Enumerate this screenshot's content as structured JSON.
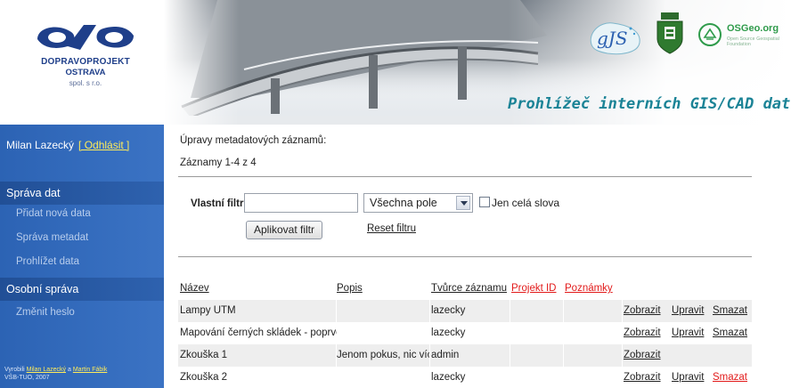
{
  "header": {
    "logo": {
      "line1": "DOPRAVOPROJEKT",
      "line2": "OSTRAVA",
      "line3": "spol. s r.o."
    },
    "banner_title": "Prohlížeč interních GIS/CAD dat",
    "osgeo_text": "OSGeo.org",
    "osgeo_sub": "Open Source Geospatial Foundation",
    "colors": {
      "title": "#1b8396",
      "logo_blue": "#1f3f8a",
      "osgeo_green": "#2f9b4b"
    }
  },
  "sidebar": {
    "user_name": "Milan Lazecký",
    "logout_label": "[ Odhlásit ]",
    "data_section": "Správa dat",
    "data_items": [
      "Přidat nová data",
      "Správa metadat",
      "Prohlížet data"
    ],
    "personal_section": "Osobní správa",
    "personal_items": [
      "Změnit heslo"
    ],
    "credits": {
      "prefix": "Vyrobili",
      "author1": "Milan Lazecký",
      "and": "a",
      "author2": "Martin Fábik",
      "org": "VŠB-TUO, 2007"
    },
    "colors": {
      "background": "#3b73c4",
      "link": "#ffec5a"
    }
  },
  "main": {
    "title": "Úpravy metadatových záznamů:",
    "records_label": "Záznamy 1-4 z 4",
    "filter": {
      "label": "Vlastní filtr",
      "input_value": "",
      "field_select_value": "Všechna pole",
      "whole_words_label": "Jen celá slova",
      "whole_words_checked": false,
      "apply_label": "Aplikovat filtr",
      "reset_label": "Reset filtru"
    },
    "table": {
      "columns": [
        "Název",
        "Popis",
        "Tvůrce záznamu",
        "Projekt ID",
        "Poznámky"
      ],
      "rows": [
        {
          "name": "Lampy UTM",
          "description": "",
          "author": "lazecky",
          "project_id": "",
          "notes": "",
          "show": "Zobrazit",
          "edit": "Upravit",
          "delete": "Smazat",
          "delete_highlight": false
        },
        {
          "name": "Mapování černých skládek - poprvé",
          "description": "",
          "author": "lazecky",
          "project_id": "",
          "notes": "",
          "show": "Zobrazit",
          "edit": "Upravit",
          "delete": "Smazat",
          "delete_highlight": false
        },
        {
          "name": "Zkouška 1",
          "description": "Jenom pokus, nic víc",
          "author": "admin",
          "project_id": "",
          "notes": "",
          "show": "Zobrazit",
          "edit": "",
          "delete": "",
          "delete_highlight": false
        },
        {
          "name": "Zkouška 2",
          "description": "",
          "author": "lazecky",
          "project_id": "",
          "notes": "",
          "show": "Zobrazit",
          "edit": "Upravit",
          "delete": "Smazat",
          "delete_highlight": true
        }
      ]
    }
  }
}
